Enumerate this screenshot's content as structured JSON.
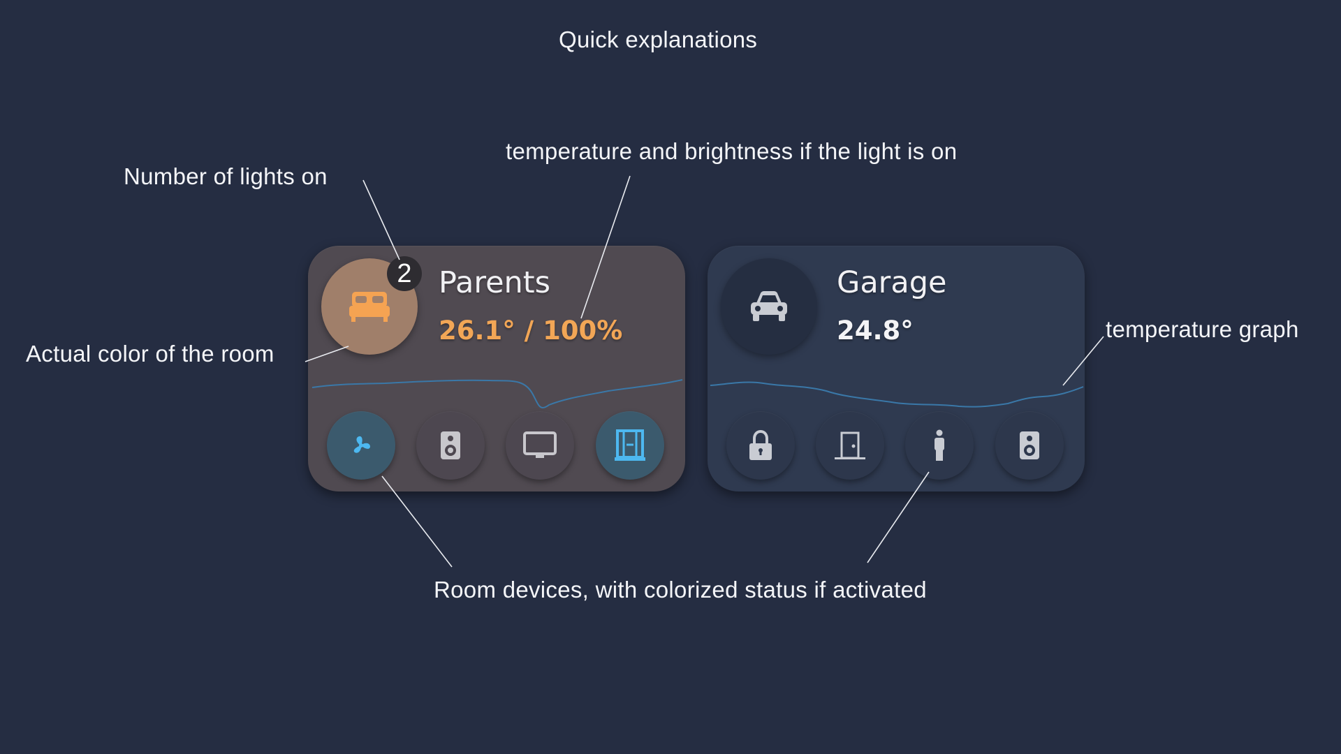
{
  "annotations": {
    "title": "Quick explanations",
    "temperature_brightness": "temperature and brightness if the light is on",
    "lights_count": "Number of lights on",
    "room_color": "Actual color of the room",
    "temperature_graph": "temperature graph",
    "room_devices": "Room devices, with colorized status if activated"
  },
  "colors": {
    "background": "#252d42",
    "parents_card": "#504a51",
    "garage_card": "#2f3a50",
    "parents_room_color": "#a07f6a",
    "accent_orange": "#f2a656",
    "device_active_blue": "#4db8f0",
    "graph_line": "#3a78a8"
  },
  "cards": [
    {
      "name": "Parents",
      "stats": "26.1° / 100%",
      "lights_on": "2",
      "room_icon": "bed-icon",
      "devices": [
        {
          "icon": "fan-icon",
          "active": true
        },
        {
          "icon": "speaker-icon",
          "active": false
        },
        {
          "icon": "tv-icon",
          "active": false
        },
        {
          "icon": "window-icon",
          "active": true
        }
      ]
    },
    {
      "name": "Garage",
      "stats": "24.8°",
      "room_icon": "car-icon",
      "devices": [
        {
          "icon": "lock-icon",
          "active": false
        },
        {
          "icon": "door-icon",
          "active": false
        },
        {
          "icon": "person-icon",
          "active": false
        },
        {
          "icon": "speaker-icon",
          "active": false
        }
      ]
    }
  ]
}
